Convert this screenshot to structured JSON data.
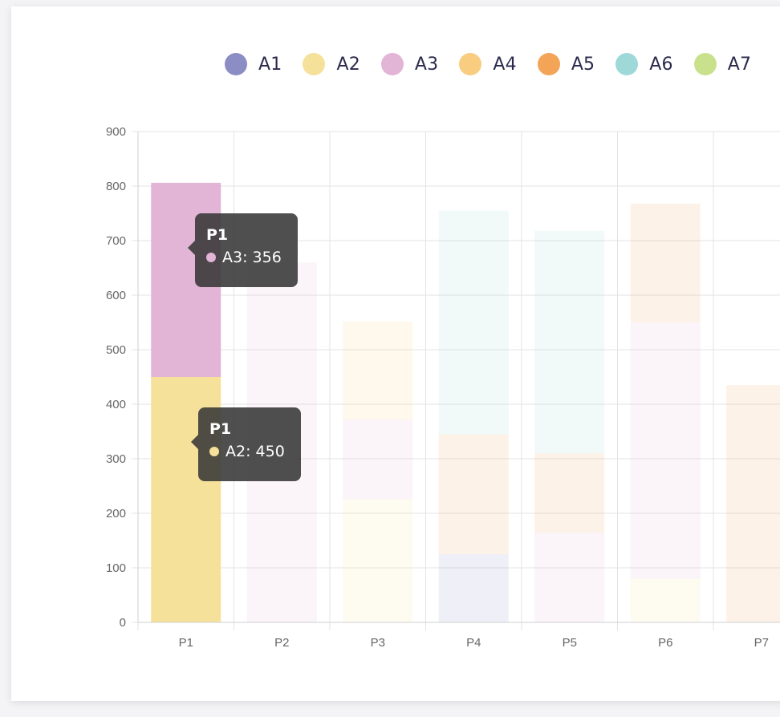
{
  "chart_data": {
    "type": "bar",
    "stacked": true,
    "categories": [
      "P1",
      "P2",
      "P3",
      "P4",
      "P5",
      "P6",
      "P7"
    ],
    "ylim": [
      0,
      900
    ],
    "yticks": [
      0,
      100,
      200,
      300,
      400,
      500,
      600,
      700,
      800,
      900
    ],
    "grid": true,
    "legend_position": "top-right",
    "highlighted_category": "P1",
    "series": [
      {
        "name": "A1",
        "color": "#8b8dc4",
        "values": [
          0,
          0,
          0,
          125,
          0,
          0,
          0
        ]
      },
      {
        "name": "A2",
        "color": "#f6e19a",
        "values": [
          450,
          0,
          226,
          0,
          0,
          80,
          0
        ]
      },
      {
        "name": "A3",
        "color": "#e2b4d5",
        "values": [
          356,
          660,
          146,
          0,
          165,
          470,
          0
        ]
      },
      {
        "name": "A4",
        "color": "#f8cd80",
        "values": [
          0,
          0,
          180,
          0,
          0,
          0,
          0
        ]
      },
      {
        "name": "A5",
        "color": "#f4a456",
        "values": [
          0,
          0,
          0,
          220,
          145,
          218,
          435
        ]
      },
      {
        "name": "A6",
        "color": "#9ed9d8",
        "values": [
          0,
          0,
          0,
          410,
          408,
          0,
          0
        ]
      },
      {
        "name": "A7",
        "color": "#c9e18c",
        "values": [
          0,
          0,
          0,
          0,
          0,
          0,
          0
        ]
      }
    ]
  },
  "legend": [
    {
      "label": "A1",
      "color": "#8b8dc4"
    },
    {
      "label": "A2",
      "color": "#f6e19a"
    },
    {
      "label": "A3",
      "color": "#e2b4d5"
    },
    {
      "label": "A4",
      "color": "#f8cd80"
    },
    {
      "label": "A5",
      "color": "#f4a456"
    },
    {
      "label": "A6",
      "color": "#9ed9d8"
    },
    {
      "label": "A7",
      "color": "#c9e18c"
    }
  ],
  "tooltips": [
    {
      "title": "P1",
      "text": "A3: 356",
      "color": "#e2b4d5"
    },
    {
      "title": "P1",
      "text": "A2: 450",
      "color": "#f6e19a"
    }
  ]
}
